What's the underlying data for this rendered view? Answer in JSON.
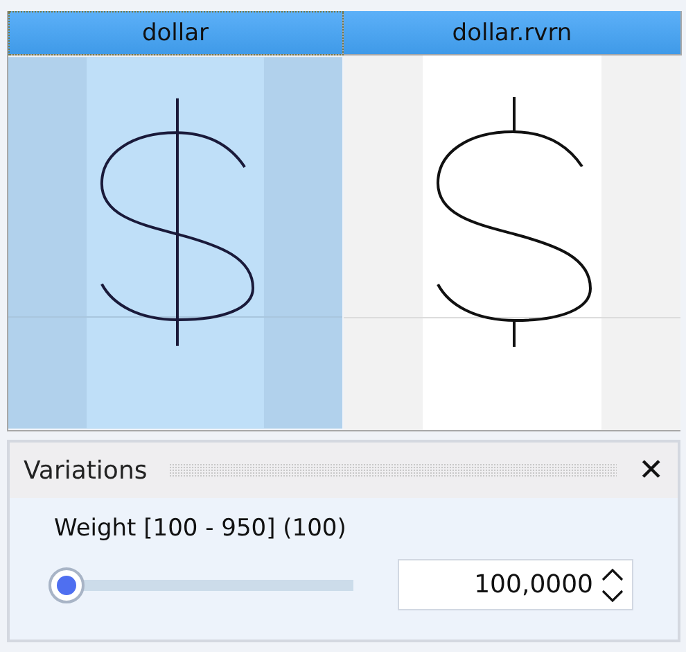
{
  "glyphs": [
    {
      "name": "dollar",
      "selected": true,
      "kind": "full-stroke"
    },
    {
      "name": "dollar.rvrn",
      "selected": false,
      "kind": "split-stroke"
    }
  ],
  "variations": {
    "title": "Variations",
    "close": "✕",
    "axes": [
      {
        "label": "Weight [100 - 950] (100)",
        "level": 0,
        "value": "100,0000"
      }
    ]
  }
}
